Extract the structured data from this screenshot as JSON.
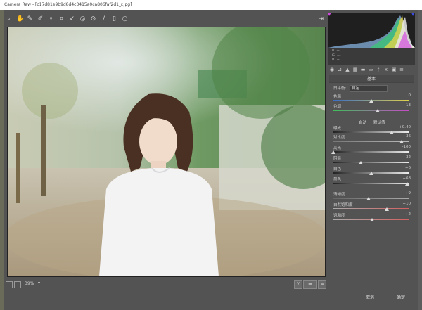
{
  "window": {
    "title": "Camera Raw - [c17d81e9b9d8d4c3415a0ca806faf2d1_r.jpg]"
  },
  "toolbar": {
    "tools": [
      "zoom-icon",
      "hand-icon",
      "white-balance-icon",
      "color-sampler-icon",
      "targeted-adjustment-icon",
      "crop-icon",
      "straighten-icon",
      "spot-removal-icon",
      "red-eye-icon",
      "adjustment-brush-icon",
      "graduated-filter-icon",
      "radial-filter-icon"
    ],
    "right_tool": "open-preferences-icon"
  },
  "bottombar": {
    "zoom": "39%"
  },
  "histogram": {
    "info": [
      "R: ---",
      "G: ---",
      "B: ---"
    ]
  },
  "panel": {
    "title": "基本",
    "tabs": [
      "basic",
      "tone-curve",
      "detail",
      "hsl",
      "split-toning",
      "lens",
      "effects",
      "camera-calibration",
      "presets",
      "snapshots"
    ],
    "white_balance": {
      "label": "白平衡:",
      "value": "自定"
    },
    "links": {
      "auto": "自动",
      "default": "默认值"
    },
    "sliders": [
      {
        "label": "色温",
        "value": "0",
        "pos": 0.5
      },
      {
        "label": "色调",
        "value": "+13",
        "pos": 0.58
      },
      {
        "label": "曝光",
        "value": "+0.40",
        "pos": 0.77
      },
      {
        "label": "对比度",
        "value": "+36",
        "pos": 0.9
      },
      {
        "label": "高光",
        "value": "-100",
        "pos": 0.0
      },
      {
        "label": "阴影",
        "value": "-32",
        "pos": 0.36
      },
      {
        "label": "白色",
        "value": "+6",
        "pos": 0.5
      },
      {
        "label": "黑色",
        "value": "+68",
        "pos": 0.97
      },
      {
        "label": "清晰度",
        "value": "+9",
        "pos": 0.46
      },
      {
        "label": "自然饱和度",
        "value": "+10",
        "pos": 0.7
      },
      {
        "label": "饱和度",
        "value": "+2",
        "pos": 0.51
      }
    ]
  },
  "footer": {
    "cancel": "取消",
    "ok": "确定"
  },
  "colors": {
    "panel_bg": "#535353",
    "preview_bg": "#2a2a2a"
  }
}
